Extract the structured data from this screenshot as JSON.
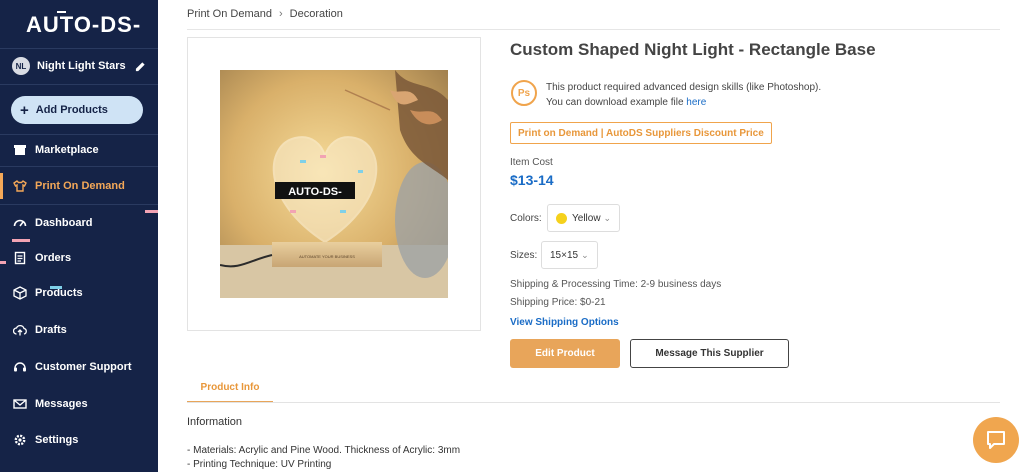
{
  "app": {
    "logo": "AUTO-DS-"
  },
  "store": {
    "initials": "NL",
    "name": "Night Light Stars"
  },
  "sidebar": {
    "add_label": "Add Products",
    "items": [
      {
        "label": "Marketplace",
        "icon": "store-icon"
      },
      {
        "label": "Print On Demand",
        "icon": "shirt-icon",
        "active": true
      },
      {
        "label": "Dashboard",
        "icon": "gauge-icon"
      },
      {
        "label": "Orders",
        "icon": "clipboard-icon"
      },
      {
        "label": "Products",
        "icon": "box-icon"
      },
      {
        "label": "Drafts",
        "icon": "cloud-upload-icon"
      },
      {
        "label": "Customer Support",
        "icon": "headset-icon"
      },
      {
        "label": "Messages",
        "icon": "mail-icon"
      },
      {
        "label": "Settings",
        "icon": "gear-icon"
      }
    ]
  },
  "breadcrumb": [
    "Print On Demand",
    "Decoration"
  ],
  "product": {
    "title": "Custom Shaped Night Light - Rectangle Base",
    "photo_logo": "AUTO-DS-",
    "photo_base_text": "AUTOMATE YOUR BUSINESS",
    "ps_badge": "Ps",
    "ps_line1": "This product required advanced design skills (like Photoshop).",
    "ps_line2": "You can download example file",
    "ps_link": "here",
    "discount_label": "Print on Demand | AutoDS Suppliers Discount Price",
    "cost_label": "Item Cost",
    "cost_value": "$13-14",
    "colors_label": "Colors:",
    "color_value": "Yellow",
    "sizes_label": "Sizes:",
    "size_value": "15×15",
    "shipping_time": "Shipping & Processing Time: 2-9 business days",
    "shipping_price": "Shipping Price: $0-21",
    "shipping_link": "View Shipping Options",
    "edit_label": "Edit Product",
    "message_label": "Message This Supplier"
  },
  "tabs": {
    "product_info": "Product Info"
  },
  "info": {
    "heading": "Information",
    "lines": [
      "- Materials: Acrylic and Pine Wood. Thickness of Acrylic: 3mm",
      "- Printing Technique: UV Printing"
    ]
  },
  "colors": {
    "sidebar": "#152347",
    "accent": "#e8a55a",
    "link": "#1a6cc6"
  }
}
